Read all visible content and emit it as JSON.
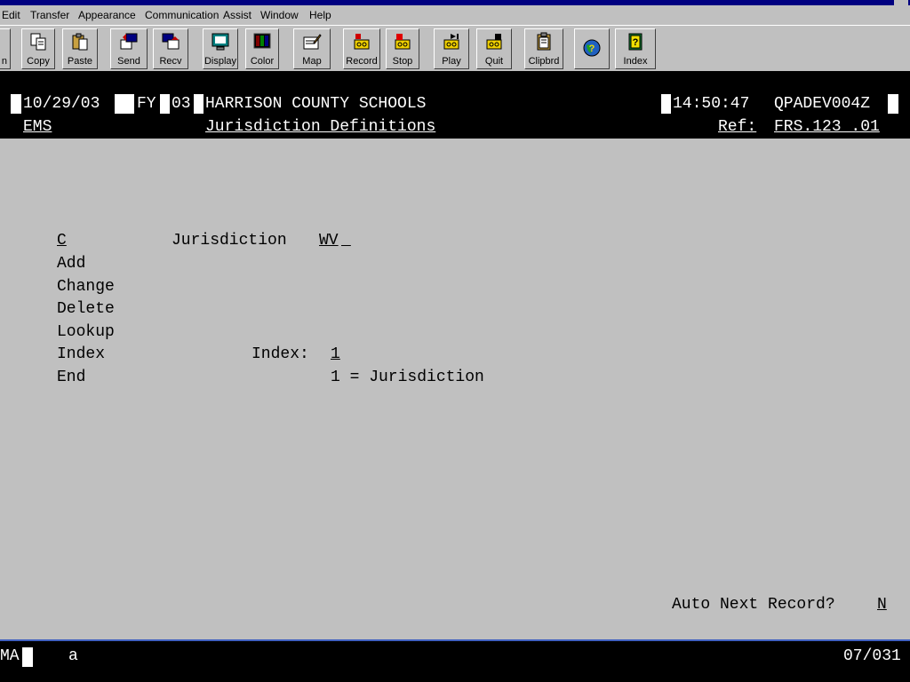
{
  "menu": [
    "Edit",
    "Transfer",
    "Appearance",
    "Communication",
    "Assist",
    "Window",
    "Help"
  ],
  "toolbar": [
    {
      "label": "n",
      "icon": "partial-icon"
    },
    {
      "label": "Copy",
      "icon": "copy-icon"
    },
    {
      "label": "Paste",
      "icon": "paste-icon"
    },
    {
      "label": "Send",
      "icon": "send-icon"
    },
    {
      "label": "Recv",
      "icon": "receive-icon"
    },
    {
      "label": "Display",
      "icon": "display-icon"
    },
    {
      "label": "Color",
      "icon": "color-icon"
    },
    {
      "label": "Map",
      "icon": "map-icon"
    },
    {
      "label": "Record",
      "icon": "record-icon"
    },
    {
      "label": "Stop",
      "icon": "stop-icon"
    },
    {
      "label": "Play",
      "icon": "play-icon"
    },
    {
      "label": "Quit",
      "icon": "quit-icon"
    },
    {
      "label": "Clipbrd",
      "icon": "clipboard-icon"
    },
    {
      "label": "",
      "icon": "globe-help-icon"
    },
    {
      "label": "Index",
      "icon": "index-book-icon"
    }
  ],
  "header": {
    "date": "10/29/03",
    "fy_label": "FY",
    "fy_value": "03",
    "org": "HARRISON COUNTY SCHOOLS",
    "time": "14:50:47",
    "session": "QPADEV004Z",
    "system": "EMS",
    "screen_title": "Jurisdiction Definitions",
    "ref_label": "Ref:",
    "ref_value": "FRS.123 .01"
  },
  "form": {
    "action_value": "C",
    "jurisdiction_label": "Jurisdiction",
    "jurisdiction_value": "WV",
    "actions": [
      "Add",
      "Change",
      "Delete",
      "Lookup",
      "Index",
      "End"
    ],
    "index_label": "Index:",
    "index_value": "1",
    "index_option": "1 = Jurisdiction",
    "auto_next_label": "Auto Next Record?",
    "auto_next_value": "N"
  },
  "status": {
    "mode": "MA",
    "indicator": "a",
    "position": "07/031"
  }
}
